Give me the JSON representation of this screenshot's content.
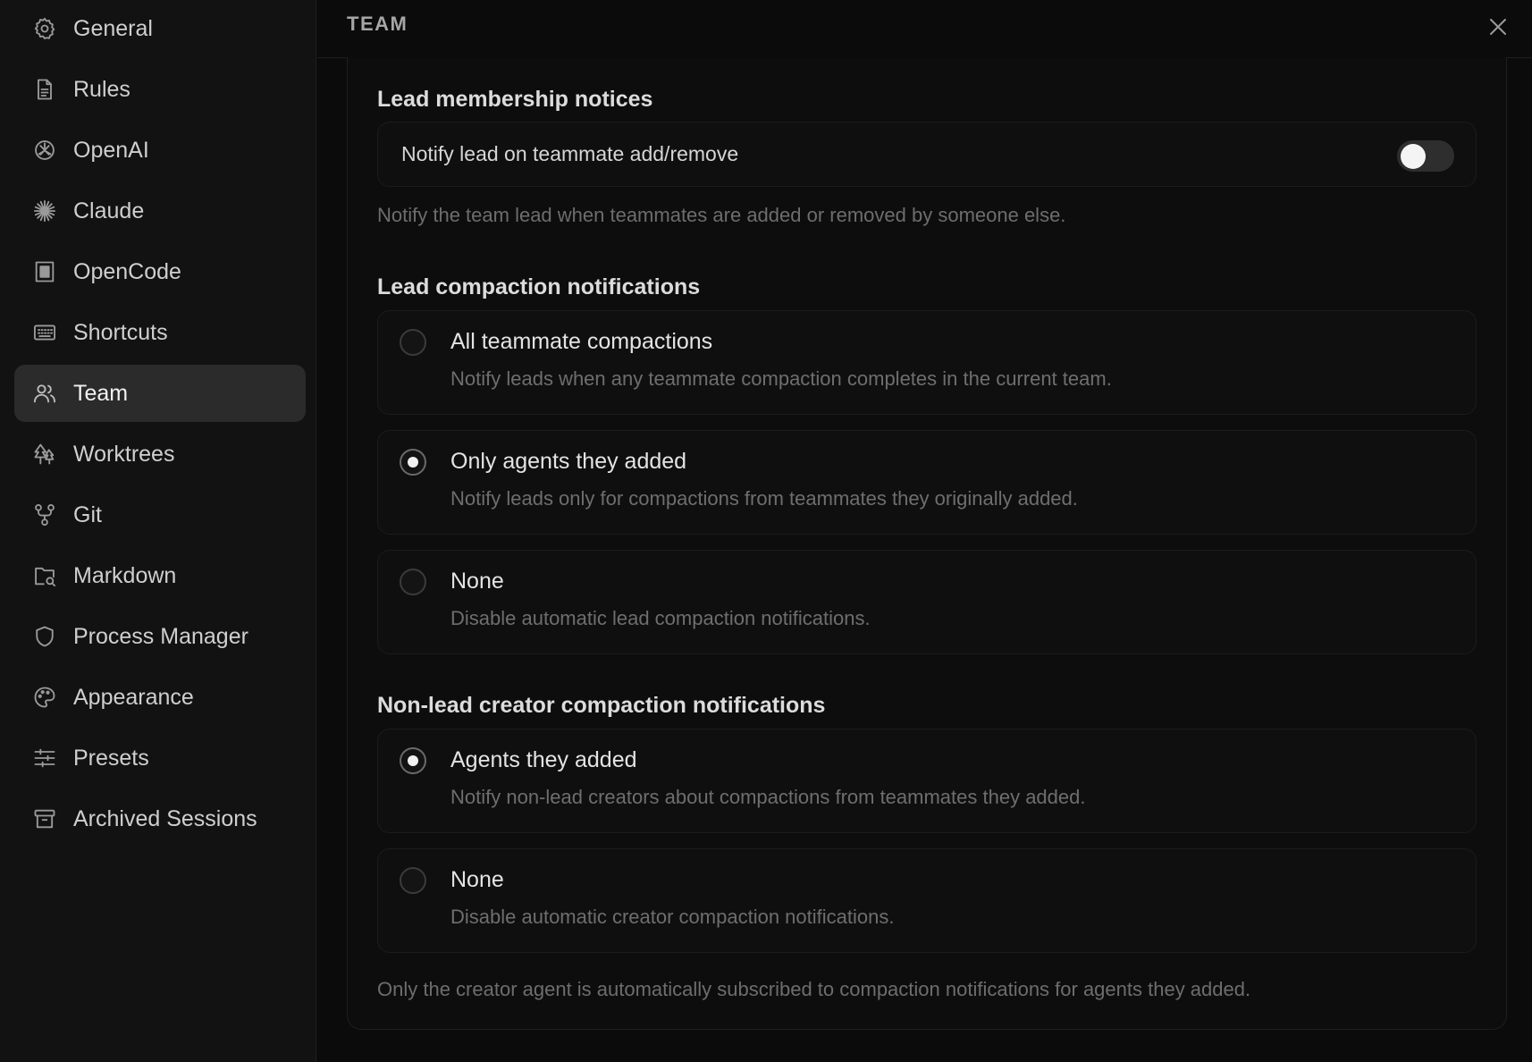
{
  "sidebar": {
    "items": [
      {
        "label": "General",
        "icon": "gear-icon"
      },
      {
        "label": "Rules",
        "icon": "document-icon"
      },
      {
        "label": "OpenAI",
        "icon": "openai-icon"
      },
      {
        "label": "Claude",
        "icon": "claude-icon"
      },
      {
        "label": "OpenCode",
        "icon": "opencode-icon"
      },
      {
        "label": "Shortcuts",
        "icon": "keyboard-icon"
      },
      {
        "label": "Team",
        "icon": "users-icon",
        "active": true
      },
      {
        "label": "Worktrees",
        "icon": "trees-icon"
      },
      {
        "label": "Git",
        "icon": "git-branch-icon"
      },
      {
        "label": "Markdown",
        "icon": "folder-search-icon"
      },
      {
        "label": "Process Manager",
        "icon": "shield-icon"
      },
      {
        "label": "Appearance",
        "icon": "palette-icon"
      },
      {
        "label": "Presets",
        "icon": "sliders-icon"
      },
      {
        "label": "Archived Sessions",
        "icon": "archive-icon"
      }
    ]
  },
  "header": {
    "title": "TEAM"
  },
  "lead_membership": {
    "title": "Lead membership notices",
    "toggle_label": "Notify lead on teammate add/remove",
    "toggle_on": false,
    "helper": "Notify the team lead when teammates are added or removed by someone else."
  },
  "lead_compaction": {
    "title": "Lead compaction notifications",
    "options": [
      {
        "title": "All teammate compactions",
        "desc": "Notify leads when any teammate compaction completes in the current team.",
        "selected": false
      },
      {
        "title": "Only agents they added",
        "desc": "Notify leads only for compactions from teammates they originally added.",
        "selected": true
      },
      {
        "title": "None",
        "desc": "Disable automatic lead compaction notifications.",
        "selected": false
      }
    ]
  },
  "nonlead_compaction": {
    "title": "Non-lead creator compaction notifications",
    "options": [
      {
        "title": "Agents they added",
        "desc": "Notify non-lead creators about compactions from teammates they added.",
        "selected": true
      },
      {
        "title": "None",
        "desc": "Disable automatic creator compaction notifications.",
        "selected": false
      }
    ],
    "footer": "Only the creator agent is automatically subscribed to compaction notifications for agents they added."
  }
}
